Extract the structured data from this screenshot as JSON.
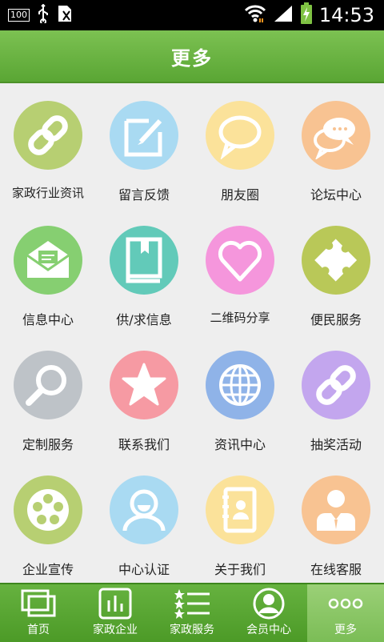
{
  "status_bar": {
    "battery_badge": "100",
    "time": "14:53"
  },
  "title": "更多",
  "colors": {
    "accent": "#5aa634",
    "circle_olive": "#b7cf72",
    "circle_blue": "#a9daf2",
    "circle_yellow": "#fbe29a",
    "circle_orange": "#f8c392",
    "circle_green": "#86cf71",
    "circle_teal": "#62cab9",
    "circle_pink": "#f596dc",
    "circle_olive2": "#b9c858",
    "circle_grey": "#bec3c8",
    "circle_rose": "#f69aa3",
    "circle_royal": "#8fb3e8",
    "circle_purple": "#c3a6ee"
  },
  "grid_items": [
    {
      "label": "家政行业资讯",
      "icon": "link-icon"
    },
    {
      "label": "留言反馈",
      "icon": "edit-icon"
    },
    {
      "label": "朋友圈",
      "icon": "speech-bubble-icon"
    },
    {
      "label": "论坛中心",
      "icon": "chat-bubbles-icon"
    },
    {
      "label": "信息中心",
      "icon": "envelope-icon"
    },
    {
      "label": "供/求信息",
      "icon": "book-icon"
    },
    {
      "label": "二维码分享",
      "icon": "heart-icon"
    },
    {
      "label": "便民服务",
      "icon": "puzzle-icon"
    },
    {
      "label": "定制服务",
      "icon": "magnifier-icon"
    },
    {
      "label": "联系我们",
      "icon": "star-icon"
    },
    {
      "label": "资讯中心",
      "icon": "globe-icon"
    },
    {
      "label": "抽奖活动",
      "icon": "link-icon"
    },
    {
      "label": "企业宣传",
      "icon": "film-reel-icon"
    },
    {
      "label": "中心认证",
      "icon": "user-smile-icon"
    },
    {
      "label": "关于我们",
      "icon": "contact-book-icon"
    },
    {
      "label": "在线客服",
      "icon": "customer-service-icon"
    }
  ],
  "tabs": [
    {
      "label": "首页",
      "icon": "pages-icon"
    },
    {
      "label": "家政企业",
      "icon": "bar-chart-icon"
    },
    {
      "label": "家政服务",
      "icon": "star-list-icon"
    },
    {
      "label": "会员中心",
      "icon": "member-icon"
    },
    {
      "label": "更多",
      "icon": "more-dots-icon",
      "active": true
    }
  ]
}
